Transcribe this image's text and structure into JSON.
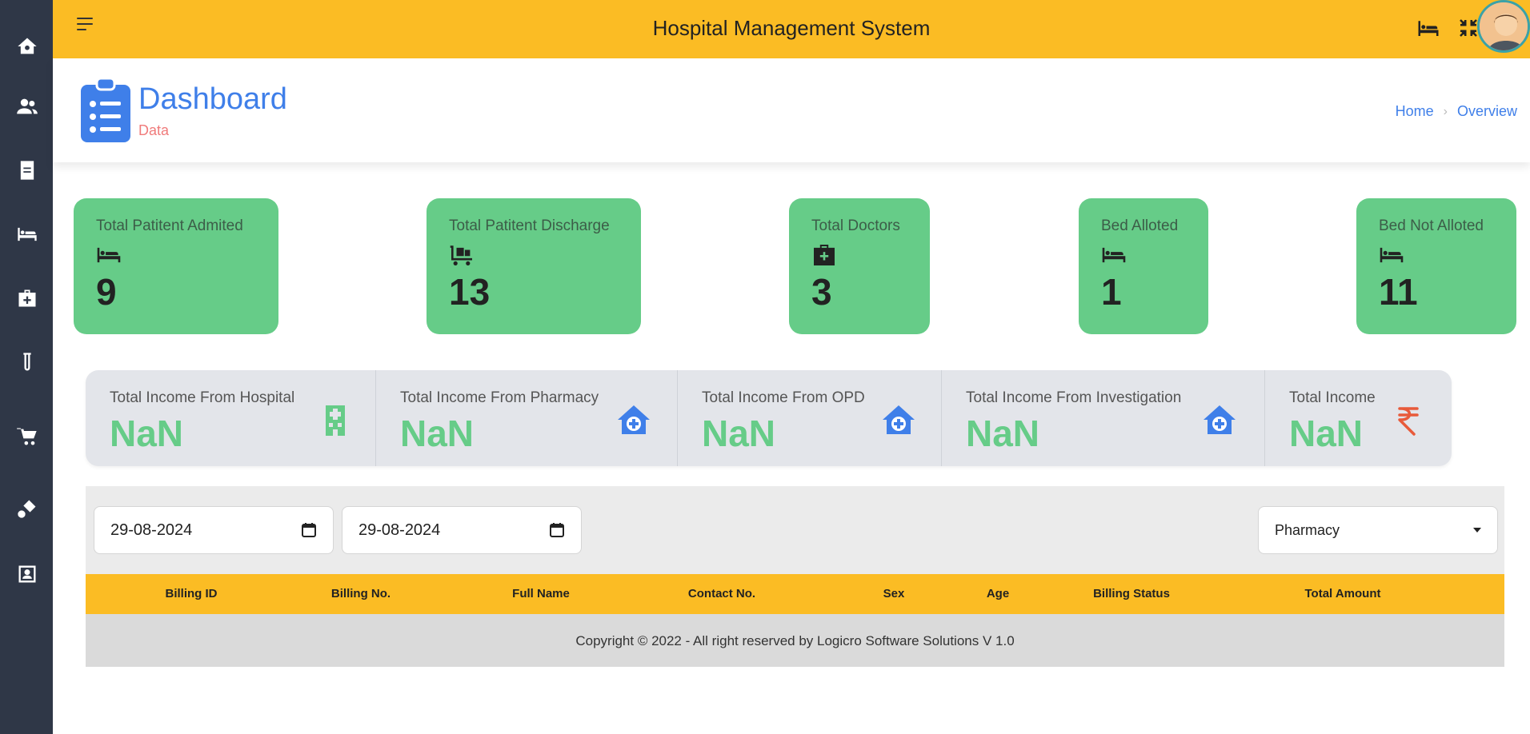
{
  "app": {
    "title": "Hospital Management System"
  },
  "sidebar": {
    "items": [
      {
        "icon": "home-gear-icon"
      },
      {
        "icon": "users-icon"
      },
      {
        "icon": "document-icon"
      },
      {
        "icon": "bed-icon"
      },
      {
        "icon": "medical-kit-icon"
      },
      {
        "icon": "test-tube-icon"
      },
      {
        "icon": "cart-plus-icon"
      },
      {
        "icon": "pills-icon"
      },
      {
        "icon": "user-card-icon"
      }
    ]
  },
  "header": {
    "title": "Dashboard",
    "subtitle": "Data",
    "breadcrumb": {
      "home": "Home",
      "current": "Overview"
    }
  },
  "stats": [
    {
      "label": "Total Patitent Admited",
      "icon": "bed-icon",
      "value": "9"
    },
    {
      "label": "Total Patitent Discharge",
      "icon": "discharge-cart-icon",
      "value": "13"
    },
    {
      "label": "Total Doctors",
      "icon": "medical-kit-icon",
      "value": "3"
    },
    {
      "label": "Bed Alloted",
      "icon": "bed-icon",
      "value": "1"
    },
    {
      "label": "Bed Not Alloted",
      "icon": "bed-icon",
      "value": "11"
    }
  ],
  "income": [
    {
      "label": "Total Income From Hospital",
      "value": "NaN",
      "icon": "hospital-building-icon",
      "color": "#66cc88"
    },
    {
      "label": "Total Income From Pharmacy",
      "value": "NaN",
      "icon": "clinic-house-icon",
      "color": "#3f7fe9"
    },
    {
      "label": "Total Income From OPD",
      "value": "NaN",
      "icon": "clinic-house-icon",
      "color": "#3f7fe9"
    },
    {
      "label": "Total Income From Investigation",
      "value": "NaN",
      "icon": "clinic-house-icon",
      "color": "#3f7fe9"
    },
    {
      "label": "Total Income",
      "value": "NaN",
      "icon": "rupee-icon",
      "color": "#e85a3a"
    }
  ],
  "filters": {
    "from_date": "29-08-2024",
    "to_date": "29-08-2024",
    "department": "Pharmacy"
  },
  "table": {
    "columns": [
      "Billing ID",
      "Billing No.",
      "Full Name",
      "Contact No.",
      "Sex",
      "Age",
      "Billing Status",
      "Total Amount"
    ]
  },
  "footer": {
    "text": "Copyright © 2022 - All right reserved by Logicro Software Solutions V 1.0"
  },
  "colors": {
    "topbar": "#fbbc24",
    "sidebar": "#2f3747",
    "card": "#66cc88",
    "accent": "#3f7fe9"
  }
}
